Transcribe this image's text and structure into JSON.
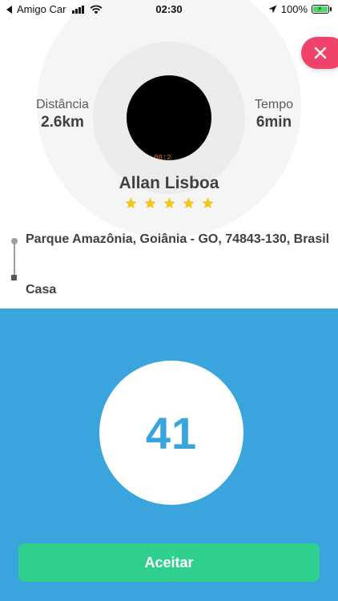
{
  "status_bar": {
    "carrier": "Amigo Car",
    "time": "02:30",
    "battery": "100%"
  },
  "ride_request": {
    "distance_label": "Distância",
    "distance_value": "2.6km",
    "time_label": "Tempo",
    "time_value": "6min",
    "avatar_stamp": "20 08:2",
    "driver_name": "Allan Lisboa",
    "rating": 5,
    "rating_max": 5,
    "origin": "Parque Amazônia, Goiânia - GO, 74843-130, Brasil",
    "destination": "Casa"
  },
  "countdown": {
    "value": "41"
  },
  "actions": {
    "accept_label": "Aceitar"
  },
  "colors": {
    "panel_blue": "#3aa5dd",
    "accept_green": "#2fcf8d",
    "close_red": "#f0436a",
    "star_yellow": "#f5c518"
  }
}
